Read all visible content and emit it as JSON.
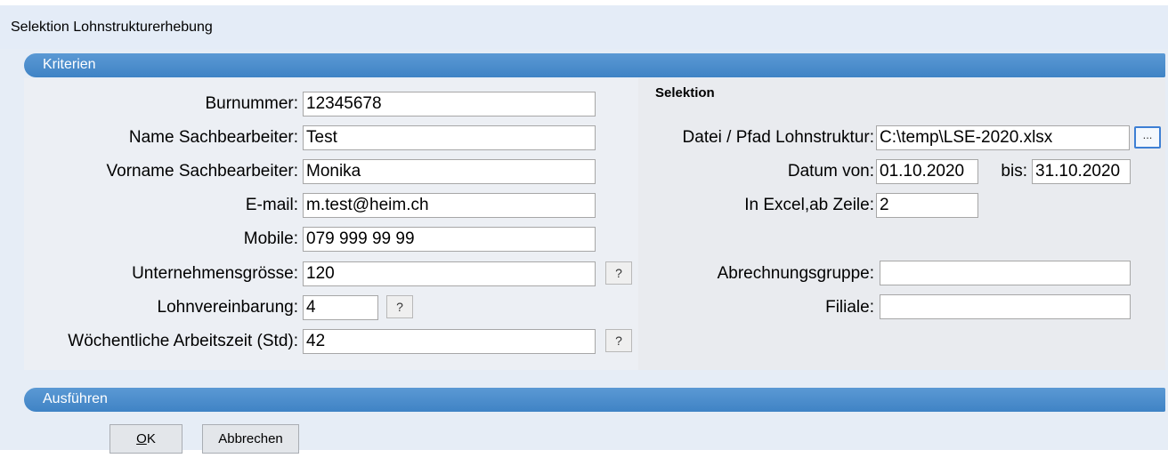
{
  "window": {
    "title": "Selektion Lohnstrukturerhebung"
  },
  "sections": {
    "kriterien": "Kriterien",
    "ausfuehren": "Ausführen"
  },
  "left_fields": {
    "burnummer": {
      "label": "Burnummer:",
      "value": "12345678"
    },
    "name": {
      "label": "Name Sachbearbeiter:",
      "value": "Test"
    },
    "vorname": {
      "label": "Vorname Sachbearbeiter:",
      "value": "Monika"
    },
    "email": {
      "label": "E-mail:",
      "value": "m.test@heim.ch"
    },
    "mobile": {
      "label": "Mobile:",
      "value": "079 999 99 99"
    },
    "unternehmensgroesse": {
      "label": "Unternehmensgrösse:",
      "value": "120"
    },
    "lohnvereinbarung": {
      "label": "Lohnvereinbarung:",
      "value": "4"
    },
    "arbeitszeit": {
      "label": "Wöchentliche Arbeitszeit (Std):",
      "value": "42"
    }
  },
  "help_button_label": "?",
  "selektion": {
    "heading": "Selektion",
    "datei": {
      "label": "Datei / Pfad Lohnstruktur:",
      "value": "C:\\temp\\LSE-2020.xlsx"
    },
    "browse_label": "...",
    "datum_von": {
      "label": "Datum von:",
      "value": "01.10.2020"
    },
    "bis": {
      "label": "bis:",
      "value": "31.10.2020"
    },
    "ab_zeile": {
      "label": "In Excel,ab Zeile:",
      "value": "2"
    },
    "abrechnungsgruppe": {
      "label": "Abrechnungsgruppe:",
      "value": ""
    },
    "filiale": {
      "label": "Filiale:",
      "value": ""
    }
  },
  "buttons": {
    "ok_underlined": "O",
    "ok_rest": "K",
    "cancel": "Abbrechen"
  }
}
